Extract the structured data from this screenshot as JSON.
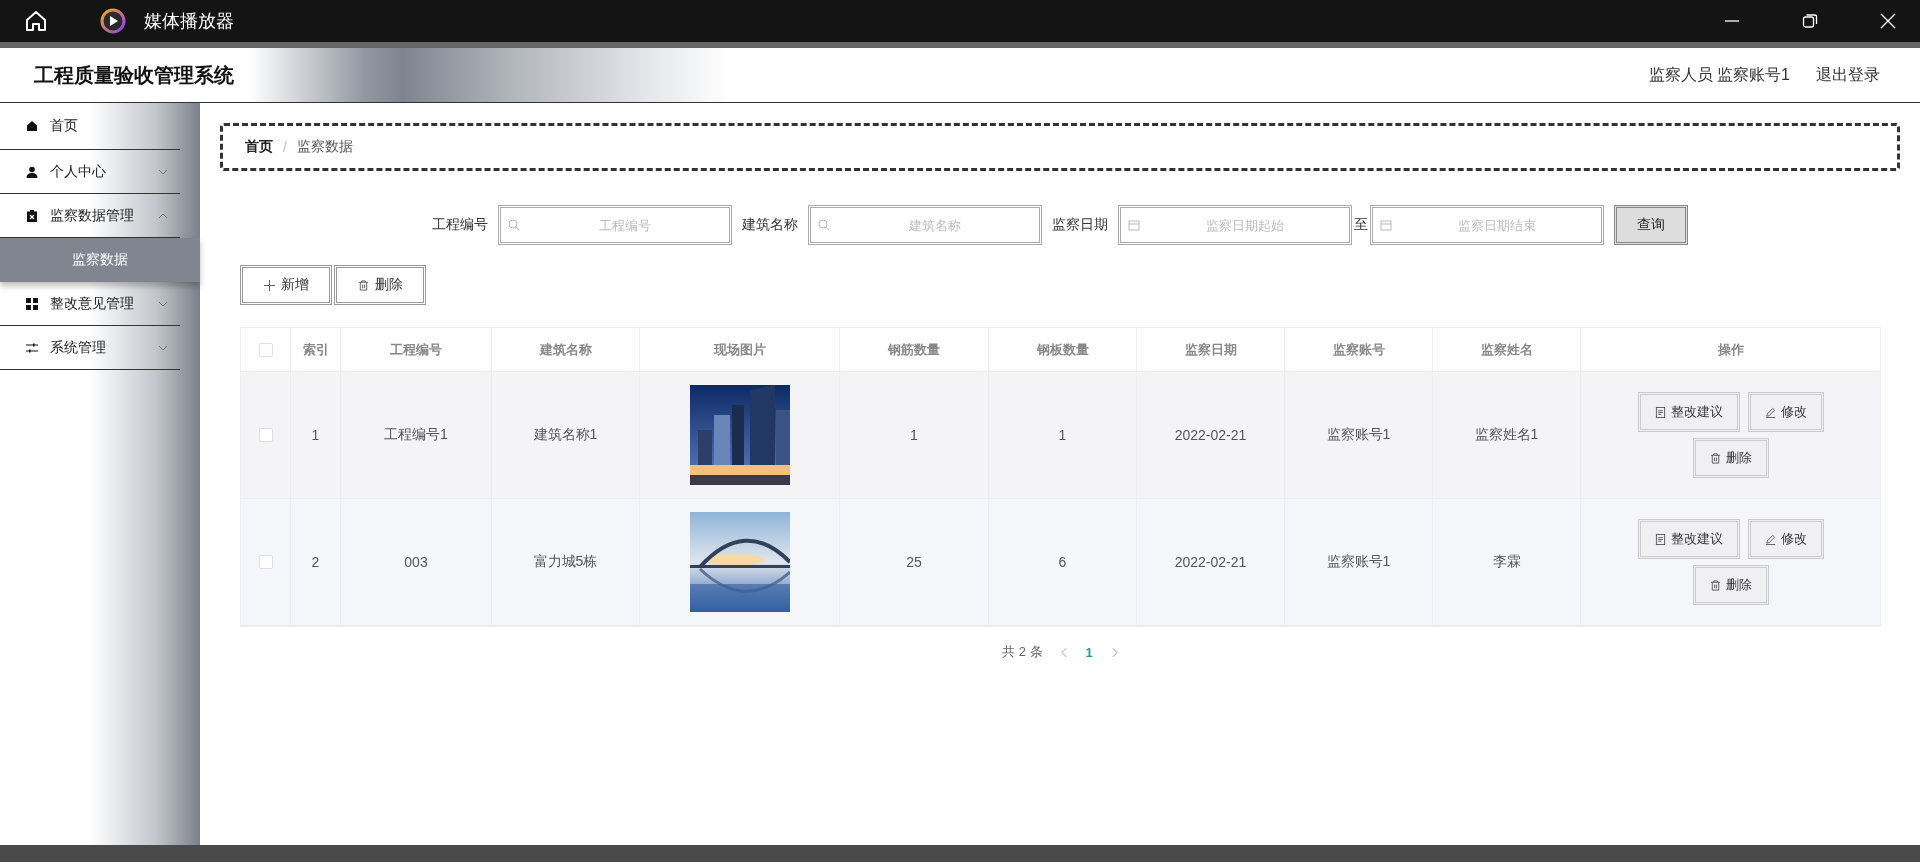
{
  "window": {
    "title": "媒体播放器"
  },
  "header": {
    "title": "工程质量验收管理系统",
    "user": "监察人员 监察账号1",
    "logout": "退出登录"
  },
  "sidebar": {
    "items": [
      {
        "label": "首页",
        "kind": "home"
      },
      {
        "label": "个人中心",
        "kind": "user",
        "expanded": false
      },
      {
        "label": "监察数据管理",
        "kind": "clipboard",
        "expanded": true,
        "children": [
          {
            "label": "监察数据",
            "selected": true
          }
        ]
      },
      {
        "label": "整改意见管理",
        "kind": "grid",
        "expanded": false
      },
      {
        "label": "系统管理",
        "kind": "sliders",
        "expanded": false
      }
    ]
  },
  "breadcrumb": {
    "items": [
      "首页",
      "监察数据"
    ],
    "separator": "/"
  },
  "filters": [
    {
      "kind": "text",
      "label": "工程编号",
      "placeholder": "工程编号"
    },
    {
      "kind": "text",
      "label": "建筑名称",
      "placeholder": "建筑名称"
    },
    {
      "kind": "daterange",
      "label": "监察日期",
      "from": {
        "placeholder": "监察日期起始"
      },
      "separator": "至",
      "to": {
        "placeholder": "监察日期结束"
      }
    }
  ],
  "query_button": "查询",
  "toolbar": [
    {
      "kind": "add",
      "label": "新增"
    },
    {
      "kind": "delete",
      "label": "删除"
    }
  ],
  "table": {
    "select_all": {
      "checked": false
    },
    "columns": [
      "索引",
      "工程编号",
      "建筑名称",
      "现场图片",
      "钢筋数量",
      "钢板数量",
      "监察日期",
      "监察账号",
      "监察姓名",
      "操作"
    ],
    "rows": [
      {
        "checked": false,
        "cells": [
          "1",
          "工程编号1",
          "建筑名称1",
          {
            "kind": "picture"
          },
          "1",
          "1",
          "2022-02-21",
          "监察账号1",
          "监察姓名1"
        ],
        "actions": [
          {
            "kind": "suggest",
            "label": "整改建议"
          },
          {
            "kind": "edit",
            "label": "修改"
          },
          {
            "kind": "delete",
            "label": "删除"
          }
        ]
      },
      {
        "checked": false,
        "cells": [
          "2",
          "003",
          "富力城5栋",
          {
            "kind": "picture"
          },
          "25",
          "6",
          "2022-02-21",
          "监察账号1",
          "李霖"
        ],
        "actions": [
          {
            "kind": "suggest",
            "label": "整改建议"
          },
          {
            "kind": "edit",
            "label": "修改"
          },
          {
            "kind": "delete",
            "label": "删除"
          }
        ]
      }
    ]
  },
  "pagination": {
    "total": "共 2 条",
    "pages": [
      {
        "label": "1",
        "selected": true
      }
    ]
  }
}
